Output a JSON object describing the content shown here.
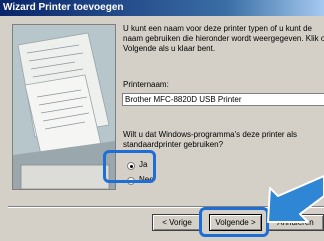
{
  "window": {
    "title": "Wizard Printer toevoegen"
  },
  "intro_text": "U kunt een naam voor deze printer typen of u kunt de naam gebruiken die hieronder wordt weergegeven. Klik op Volgende als u klaar bent.",
  "printer_name": {
    "label": "Printernaam:",
    "value": "Brother MFC-8820D USB Printer"
  },
  "default_question": "Wilt u dat Windows-programma's deze printer als standaardprinter gebruiken?",
  "options": {
    "yes": "Ja",
    "no": "Nee"
  },
  "buttons": {
    "back": "< Vorige",
    "next": "Volgende >",
    "cancel": "Annuleren"
  },
  "colors": {
    "highlight": "#1d6fd6",
    "arrow": "#2f86d4"
  }
}
